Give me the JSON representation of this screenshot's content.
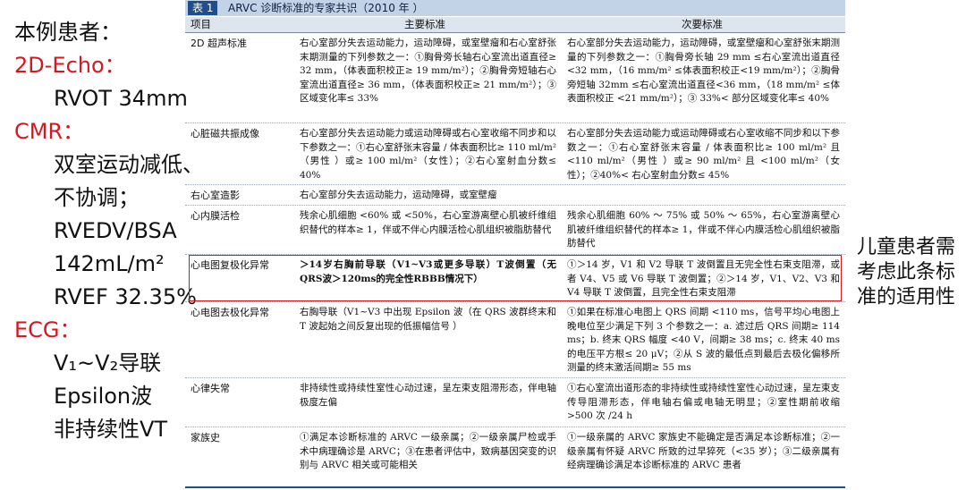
{
  "left": {
    "line1": "本例患者：",
    "echo_label": "2D-Echo：",
    "echo_value": "RVOT 34mm",
    "cmr_label": "CMR：",
    "cmr_1": "双室运动减低、",
    "cmr_2": "不协调；",
    "cmr_3": "RVEDV/BSA",
    "cmr_4": "142mL/m²",
    "cmr_5": "RVEF 32.35%",
    "ecg_label": "ECG：",
    "ecg_1": "V₁~V₂导联",
    "ecg_2": "Epsilon波",
    "ecg_3": "非持续性VT"
  },
  "note": "儿童患者需考虑此条标准的适用性",
  "table": {
    "tag": "表 1",
    "title": "ARVC 诊断标准的专家共识（2010 年 ）",
    "headers": {
      "item": "项目",
      "major": "主要标准",
      "minor": "次要标准"
    },
    "rows": [
      {
        "item": "2D 超声标准",
        "major": "右心室部分失去运动能力，运动障碍，或室壁瘤和右心室舒张末期测量的下列参数之一：①胸骨旁长轴右心室流出道直径≥ 32 mm，（体表面积校正≥ 19 mm/m²）；②胸骨旁短轴右心室流出道直径≥ 36 mm，（体表面积校正≥ 21 mm/m²）；③区域变化率≤ 33%",
        "minor": "右心室部分失去运动能力，运动障碍，或室壁瘤和心室舒张末期测量的下列参数之一：①胸骨旁长轴 29 mm ≤右心室流出道直径 <32 mm，（16 mm/m² ≤体表面积校正<19 mm/m²）；②胸骨旁短轴 32mm ≤右心室流出道直径<36 mm，（18 mm/m² ≤体表面积校正 <21 mm/m²）；③ 33%< 部分区域变化率≤ 40%"
      },
      {
        "item": "心脏磁共振成像",
        "major": "右心室部分失去运动能力或运动障碍或右心室收缩不同步和以下参数之一：①右心室舒张末容量 / 体表面积比≥ 110 ml/m²（男性 ）或≥ 100 ml/m²（女性）；②右心室射血分数≤ 40%",
        "minor": "右心室部分失去运动能力或运动障碍或右心室收缩不同步和以下参数之一：①右心室舒张末容量 / 体表面积比≥ 100 ml/m² 且 <110 ml/m²（男性 ）或≥ 90 ml/m² 且 <100 ml/m²（女性）；②40%< 右心室射血分数≤ 45%"
      },
      {
        "item": "右心室造影",
        "major": "右心室部分失去运动能力，运动障碍，或室壁瘤",
        "minor": ""
      },
      {
        "item": "心内膜活检",
        "major": "残余心肌细胞 <60% 或 <50%，右心室游离壁心肌被纤维组织替代的样本≥ 1，伴或不伴心内膜活检心肌组织被脂肪替代",
        "minor": "残余心肌细胞 60% ～ 75% 或 50% ～ 65%，右心室游离壁心肌被纤维组织替代的样本≥ 1，伴或不伴心内膜活检心肌组织被脂肪替代"
      },
      {
        "item": "心电图复极化异常",
        "major": "＞14岁右胸前导联（V1~V3或更多导联）T波倒置（无QRS波＞120ms的完全性RBBB情况下）",
        "minor": "①＞14 岁，V1 和 V2 导联 T 波倒置且无完全性右束支阻滞，或者 V4、V5 或 V6 导联 T 波倒置；②＞14 岁，V1、V2、V3 和 V4 导联 T 波倒置，且完全性右束支阻滞"
      },
      {
        "item": "心电图去极化异常",
        "major": "右胸导联（V1~V3 中出现 Epsilon 波（在 QRS 波群终末和 T 波起始之间反复出现的低振幅信号 ）",
        "minor": "①如果在标准心电图上 QRS 间期 <110 ms，信号平均心电图上晚电位至少满足下列 3 个参数之一：a. 滤过后 QRS 间期≥ 114 ms；b. 终末 QRS 幅度 <40 V，间期≥ 38 ms；c. 终末 40 ms 的电压平方根≤ 20 μV；②从 S 波的最低点到最后去极化偏移所测量的终末激活间期≥ 55 ms"
      },
      {
        "item": "心律失常",
        "major": "非持续性或持续性室性心动过速，呈左束支阻滞形态，伴电轴极度左偏",
        "minor": "①右心室流出道形态的非持续性或持续性室性心动过速，呈左束支传导阻滞形态，伴电轴右偏或电轴无明显；②室性期前收缩 >500 次 /24 h"
      },
      {
        "item": "家族史",
        "major": "①满足本诊断标准的 ARVC 一级亲属；②一级亲属尸检或手术中病理确诊是 ARVC；③在患者评估中，致病基因突变的识别与 ARVC 相关或可能相关",
        "minor": "①一级亲属的 ARVC 家族史不能确定是否满足本诊断标准；②一级亲属有怀疑 ARVC 所致的过早猝死（<35 岁）；③二级亲属有经病理确诊满足本诊断标准的 ARVC 患者"
      }
    ]
  },
  "colors": {
    "accent_red": "#d7161e",
    "table_header_blue": "#1f4e8c",
    "caption_bg": "#c3d3e7"
  }
}
